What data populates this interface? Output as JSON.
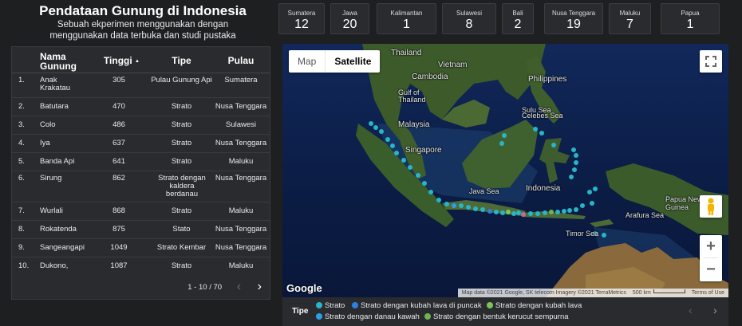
{
  "header": {
    "title": "Pendataan Gunung di Indonesia",
    "subtitle_line1": "Sebuah ekperimen menggunakan dengan",
    "subtitle_line2": "menggunakan data terbuka dan studi pustaka"
  },
  "islands": [
    {
      "label": "Sumatera",
      "count": "12"
    },
    {
      "label": "Jawa",
      "count": "20"
    },
    {
      "label": "Kalimantan",
      "count": "1"
    },
    {
      "label": "Sulawesi",
      "count": "8"
    },
    {
      "label": "Bali",
      "count": "2"
    },
    {
      "label": "Nusa Tenggara",
      "count": "19"
    },
    {
      "label": "Maluku",
      "count": "7"
    },
    {
      "label": "Papua",
      "count": "1"
    }
  ],
  "table": {
    "headers": {
      "name": "Nama Gunung",
      "height": "Tinggi",
      "type": "Tipe",
      "island": "Pulau"
    },
    "sort_indicator": "▲",
    "rows": [
      {
        "num": "1.",
        "name": "Anak Krakatau",
        "height": "305",
        "type": "Pulau Gunung Api",
        "island": "Sumatera"
      },
      {
        "num": "2.",
        "name": "Batutara",
        "height": "470",
        "type": "Strato",
        "island": "Nusa Tenggara"
      },
      {
        "num": "3.",
        "name": "Colo",
        "height": "486",
        "type": "Strato",
        "island": "Sulawesi"
      },
      {
        "num": "4.",
        "name": "Iya",
        "height": "637",
        "type": "Strato",
        "island": "Nusa Tenggara"
      },
      {
        "num": "5.",
        "name": "Banda Api",
        "height": "641",
        "type": "Strato",
        "island": "Maluku"
      },
      {
        "num": "6.",
        "name": "Sirung",
        "height": "862",
        "type": "Strato dengan kaldera berdanau",
        "island": "Nusa Tenggara"
      },
      {
        "num": "7.",
        "name": "Wurlali",
        "height": "868",
        "type": "Strato",
        "island": "Maluku"
      },
      {
        "num": "8.",
        "name": "Rokatenda",
        "height": "875",
        "type": "Stato",
        "island": "Nusa Tenggara"
      },
      {
        "num": "9.",
        "name": "Sangeangapi",
        "height": "1049",
        "type": "Strato Kembar",
        "island": "Nusa Tenggara"
      },
      {
        "num": "10.",
        "name": "Dukono,",
        "height": "1087",
        "type": "Strato",
        "island": "Maluku"
      }
    ],
    "pagination": {
      "range": "1 - 10 / 70",
      "prev": "‹",
      "next": "›"
    }
  },
  "map": {
    "type_buttons": {
      "map": "Map",
      "satellite": "Satellite"
    },
    "fullscreen_icon": "fullscreen-icon",
    "pegman_icon": "pegman-icon",
    "zoom_in": "+",
    "zoom_out": "−",
    "logo": "Google",
    "attribution": {
      "data": "Map data ©2021 Google, SK telecom Imagery ©2021 TerraMetrics",
      "scale": "500 km",
      "terms": "Terms of Use"
    },
    "labels": {
      "thailand": "Thailand",
      "vietnam": "Vietnam",
      "cambodia": "Cambodia",
      "gulf": "Gulf of Thailand",
      "philippines": "Philippines",
      "sulu": "Sulu Sea",
      "celebes": "Celebes Sea",
      "malaysia": "Malaysia",
      "singapore": "Singapore",
      "java_sea": "Java Sea",
      "indonesia": "Indonesia",
      "timor_sea": "Timor Sea",
      "papua": "Papua New Guinea",
      "arafura": "Arafura Sea"
    },
    "water_color": "#0c1e47",
    "land_color": "#3c5a2c"
  },
  "legend": {
    "title": "Tipe",
    "items": [
      {
        "label": "Strato",
        "color": "#26b6c8"
      },
      {
        "label": "Strato dengan kubah lava di puncak",
        "color": "#2f7fe0"
      },
      {
        "label": "Strato dengan kubah lava",
        "color": "#7cc45a"
      },
      {
        "label": "Strato dengan danau kawah",
        "color": "#2aa0e6"
      },
      {
        "label": "Strato dengan bentuk kerucut sempurna",
        "color": "#6fb54d"
      }
    ],
    "prev": "‹",
    "next": "›"
  }
}
